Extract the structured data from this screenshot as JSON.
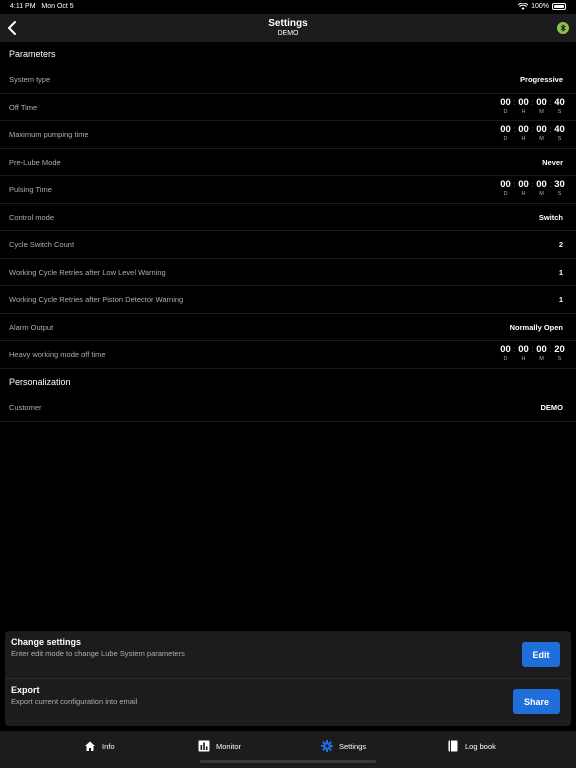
{
  "status_bar": {
    "time": "4:11 PM",
    "date": "Mon Oct 5",
    "battery": "100%"
  },
  "nav": {
    "title": "Settings",
    "subtitle": "DEMO"
  },
  "sections": {
    "parameters": "Parameters",
    "personalization": "Personalization"
  },
  "time_units": {
    "d": "D",
    "h": "H",
    "m": "M",
    "s": "S"
  },
  "rows": [
    {
      "label": "System type",
      "value": "Progressive"
    },
    {
      "label": "Off Time",
      "time": {
        "d": "00",
        "h": "00",
        "m": "00",
        "s": "40"
      }
    },
    {
      "label": "Maximum pumping time",
      "time": {
        "d": "00",
        "h": "00",
        "m": "00",
        "s": "40"
      }
    },
    {
      "label": "Pre-Lube Mode",
      "value": "Never"
    },
    {
      "label": "Pulsing Time",
      "time": {
        "d": "00",
        "h": "00",
        "m": "00",
        "s": "30"
      }
    },
    {
      "label": "Control mode",
      "value": "Switch"
    },
    {
      "label": "Cycle Switch Count",
      "value": "2"
    },
    {
      "label": "Working Cycle Retries after Low Level Warning",
      "value": "1"
    },
    {
      "label": "Working Cycle Retries after Piston Detector Warning",
      "value": "1"
    },
    {
      "label": "Alarm Output",
      "value": "Normally Open"
    },
    {
      "label": "Heavy working mode off time",
      "time": {
        "d": "00",
        "h": "00",
        "m": "00",
        "s": "20"
      }
    }
  ],
  "personalization_rows": [
    {
      "label": "Customer",
      "value": "DEMO"
    }
  ],
  "actions": {
    "change": {
      "title": "Change settings",
      "desc": "Enter edit mode to change Lube System parameters",
      "button": "Edit"
    },
    "export": {
      "title": "Export",
      "desc": "Export current configuration into email",
      "button": "Share"
    }
  },
  "tabs": [
    {
      "label": "Info",
      "icon": "home-icon"
    },
    {
      "label": "Monitor",
      "icon": "chart-icon"
    },
    {
      "label": "Settings",
      "icon": "gear-icon",
      "active": true
    },
    {
      "label": "Log book",
      "icon": "book-icon"
    }
  ],
  "colors": {
    "accent": "#1f6fdb",
    "bluetooth": "#8bc34a",
    "background": "#000000",
    "panel": "#1c1c1e"
  }
}
